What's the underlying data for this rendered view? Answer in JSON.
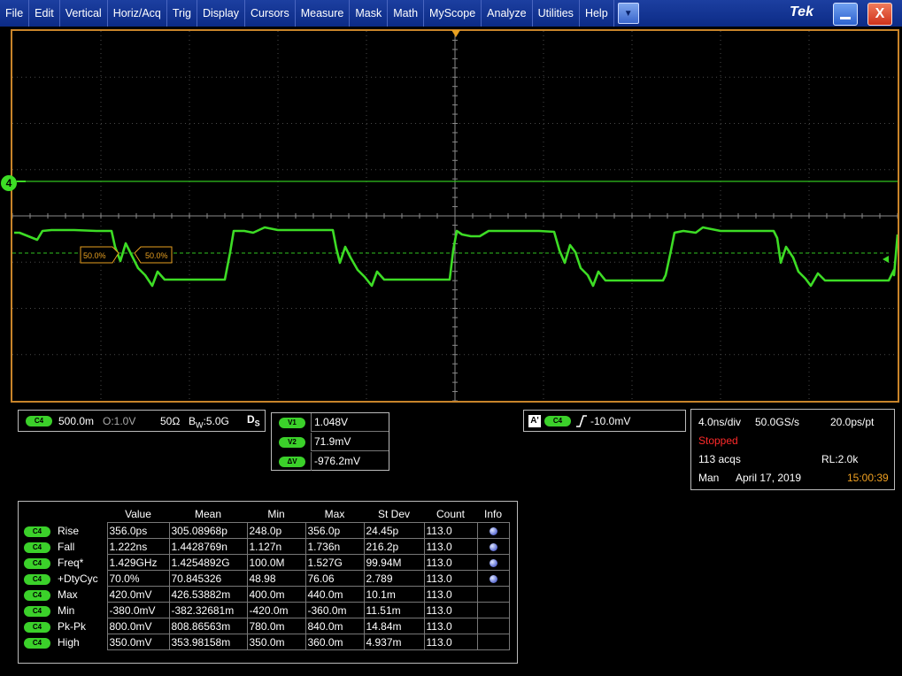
{
  "menu": {
    "items": [
      "File",
      "Edit",
      "Vertical",
      "Horiz/Acq",
      "Trig",
      "Display",
      "Cursors",
      "Measure",
      "Mask",
      "Math",
      "MyScope",
      "Analyze",
      "Utilities",
      "Help"
    ],
    "brand": "Tek",
    "close_glyph": "X"
  },
  "colors": {
    "trace": "#3ddc25",
    "border": "#c8842a",
    "trigger": "#e8a020",
    "menubar": "#1535a0"
  },
  "display": {
    "channel_marker": "4",
    "ref_level_left": "50.0%",
    "ref_level_right": "50.0%"
  },
  "channel": {
    "pill": "C4",
    "scale": "500.0m",
    "offset": "O:1.0V",
    "termination": "50Ω",
    "bandwidth": "B",
    "bandwidth_sub": "W",
    "bandwidth_value": ":5.0G",
    "ds_main": "D",
    "ds_sub": "S"
  },
  "cursors": {
    "rows": [
      {
        "label": "V1",
        "value": "1.048V"
      },
      {
        "label": "V2",
        "value": "71.9mV"
      },
      {
        "label": "ΔV",
        "value": "-976.2mV"
      }
    ]
  },
  "trigger": {
    "badge": "A'",
    "pill": "C4",
    "level": "-10.0mV"
  },
  "acquisition": {
    "timebase": "4.0ns/div",
    "sample_rate": "50.0GS/s",
    "resolution": "20.0ps/pt",
    "state": "Stopped",
    "acqs": "113 acqs",
    "record_length": "RL:2.0k",
    "mode": "Man",
    "date": "April 17, 2019",
    "time": "15:00:39"
  },
  "measurements": {
    "headers": [
      "Value",
      "Mean",
      "Min",
      "Max",
      "St Dev",
      "Count",
      "Info"
    ],
    "rows": [
      {
        "pill": "C4",
        "label": "Rise",
        "value": "356.0ps",
        "mean": "305.08968p",
        "min": "248.0p",
        "max": "356.0p",
        "stdev": "24.45p",
        "count": "113.0",
        "info": true
      },
      {
        "pill": "C4",
        "label": "Fall",
        "value": "1.222ns",
        "mean": "1.4428769n",
        "min": "1.127n",
        "max": "1.736n",
        "stdev": "216.2p",
        "count": "113.0",
        "info": true
      },
      {
        "pill": "C4",
        "label": "Freq*",
        "value": "1.429GHz",
        "mean": "1.4254892G",
        "min": "100.0M",
        "max": "1.527G",
        "stdev": "99.94M",
        "count": "113.0",
        "info": true
      },
      {
        "pill": "C4",
        "label": "+DtyCyc",
        "value": "70.0%",
        "mean": "70.845326",
        "min": "48.98",
        "max": "76.06",
        "stdev": "2.789",
        "count": "113.0",
        "info": true
      },
      {
        "pill": "C4",
        "label": "Max",
        "value": "420.0mV",
        "mean": "426.53882m",
        "min": "400.0m",
        "max": "440.0m",
        "stdev": "10.1m",
        "count": "113.0",
        "info": false
      },
      {
        "pill": "C4",
        "label": "Min",
        "value": "-380.0mV",
        "mean": "-382.32681m",
        "min": "-420.0m",
        "max": "-360.0m",
        "stdev": "11.51m",
        "count": "113.0",
        "info": false
      },
      {
        "pill": "C4",
        "label": "Pk-Pk",
        "value": "800.0mV",
        "mean": "808.86563m",
        "min": "780.0m",
        "max": "840.0m",
        "stdev": "14.84m",
        "count": "113.0",
        "info": false
      },
      {
        "pill": "C4",
        "label": "High",
        "value": "350.0mV",
        "mean": "353.98158m",
        "min": "350.0m",
        "max": "360.0m",
        "stdev": "4.937m",
        "count": "113.0",
        "info": false
      }
    ]
  }
}
